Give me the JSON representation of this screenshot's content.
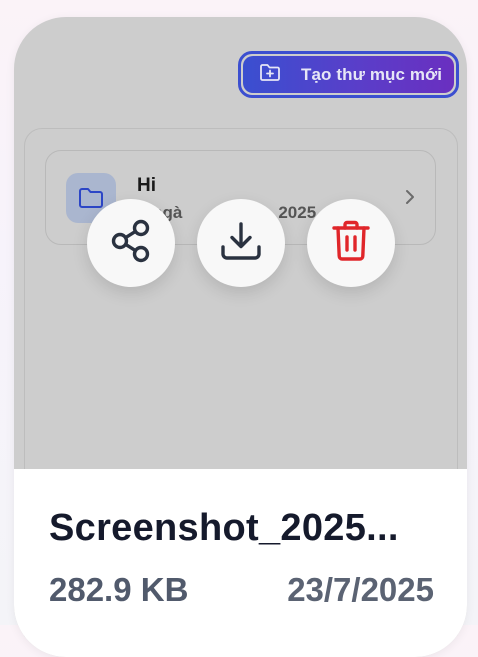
{
  "create_button": {
    "label": "Tạo thư mục mới",
    "icon": "folder-plus-icon"
  },
  "folder": {
    "name": "Hi",
    "date_visible_start": "o ngà",
    "date_visible_end": "2025",
    "icon": "folder-icon"
  },
  "actions": [
    {
      "name": "share",
      "icon": "share-icon"
    },
    {
      "name": "download",
      "icon": "download-icon"
    },
    {
      "name": "delete",
      "icon": "trash-icon"
    }
  ],
  "file": {
    "name": "Screenshot_2025...",
    "size": "282.9 KB",
    "date": "23/7/2025"
  },
  "colors": {
    "overlay": "#cdcdcd",
    "accent_start": "#3a4fd0",
    "accent_end": "#6a2fc0",
    "delete_red": "#e0262a",
    "folder_blue": "#2c46c6",
    "title_text": "#151a2c"
  }
}
